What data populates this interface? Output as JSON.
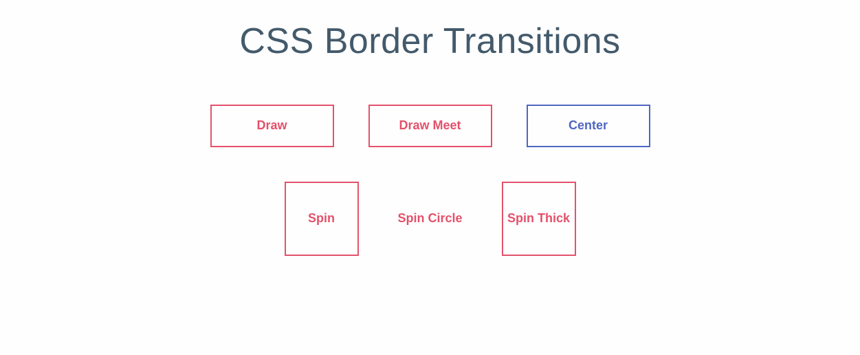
{
  "heading": "CSS Border Transitions",
  "buttons": {
    "draw": "Draw",
    "drawMeet": "Draw Meet",
    "center": "Center",
    "spin": "Spin",
    "spinCircle": "Spin Circle",
    "spinThick": "Spin Thick"
  },
  "colors": {
    "primary": "#e4516b",
    "hover": "#4f66c1",
    "heading": "#435a6b"
  }
}
